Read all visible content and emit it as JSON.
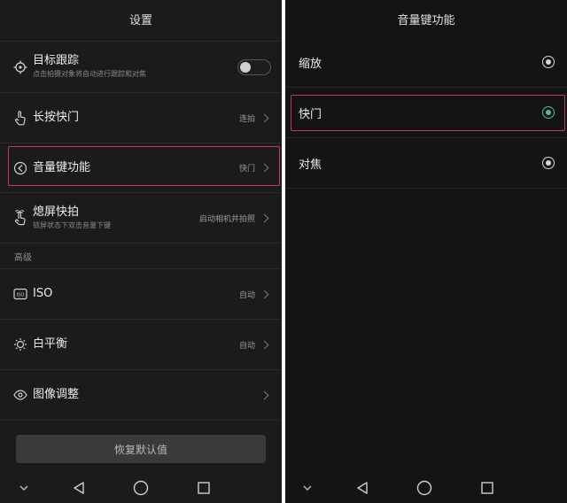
{
  "left": {
    "title": "设置",
    "rows": [
      {
        "title": "目标跟踪",
        "sub": "点击拍摄对象将自动进行跟踪和对焦",
        "icon": "target-tracking-icon",
        "toggle_on": false
      },
      {
        "title": "长按快门",
        "value": "连拍",
        "icon": "hand-press-icon"
      },
      {
        "title": "音量键功能",
        "value": "快门",
        "icon": "volume-key-icon"
      },
      {
        "title": "熄屏快拍",
        "sub": "锁屏状态下双击音量下键",
        "value": "启动相机并拍照",
        "icon": "snapshot-hand-icon"
      }
    ],
    "section_label": "高级",
    "advanced_rows": [
      {
        "title": "ISO",
        "value": "自动",
        "icon": "iso-icon"
      },
      {
        "title": "白平衡",
        "value": "自动",
        "icon": "white-balance-icon"
      },
      {
        "title": "图像调整",
        "value": "",
        "icon": "image-adjust-icon"
      }
    ],
    "reset_label": "恢复默认值"
  },
  "right": {
    "title": "音量键功能",
    "options": [
      {
        "label": "缩放",
        "selected": false
      },
      {
        "label": "快门",
        "selected": true
      },
      {
        "label": "对焦",
        "selected": false
      }
    ]
  },
  "colors": {
    "highlight": "#c23a55",
    "radio_selected": "#58b79a",
    "background": "#1b1b1b"
  }
}
